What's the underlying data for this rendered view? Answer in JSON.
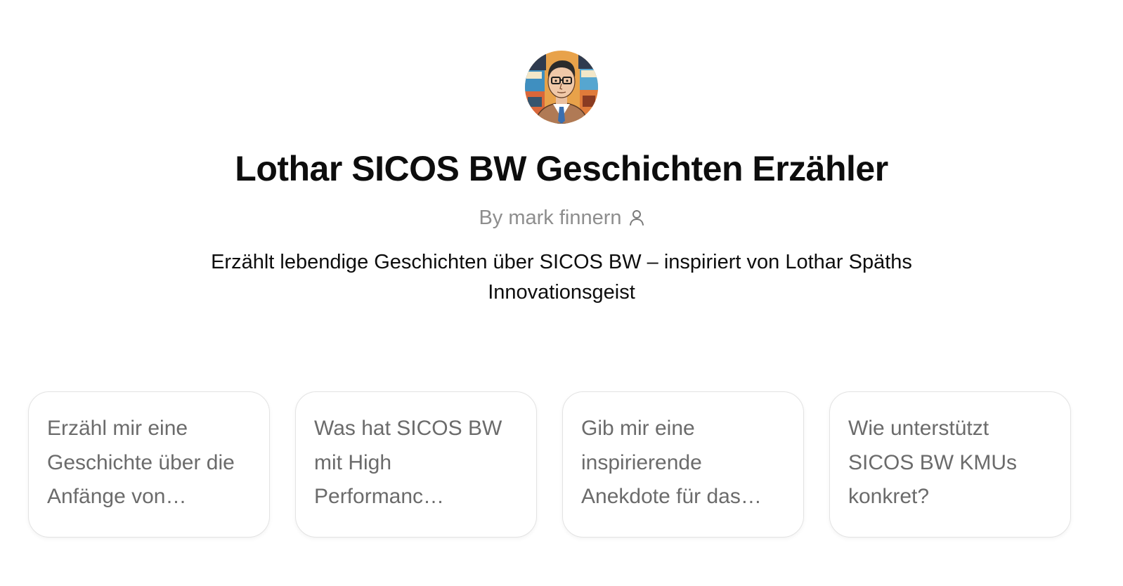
{
  "gpt": {
    "title": "Lothar SICOS BW Geschichten Erzähler",
    "byline": "By mark finnern",
    "description": "Erzählt lebendige Geschichten über SICOS BW – inspiriert von Lothar Späths Innovationsgeist",
    "avatar_icon": "comic-portrait-avatar",
    "byline_icon": "user-icon"
  },
  "starters": [
    {
      "label": "Erzähl mir eine Geschichte über die Anfänge von…"
    },
    {
      "label": "Was hat SICOS BW mit High Performanc…"
    },
    {
      "label": "Gib mir eine inspirierende Anekdote für das…"
    },
    {
      "label": "Wie unterstützt SICOS BW KMUs konkret?"
    }
  ],
  "colors": {
    "title": "#0d0d0d",
    "muted": "#8e8e8e",
    "starter_text": "#6b6b6b",
    "card_border": "#e3e3e3"
  }
}
